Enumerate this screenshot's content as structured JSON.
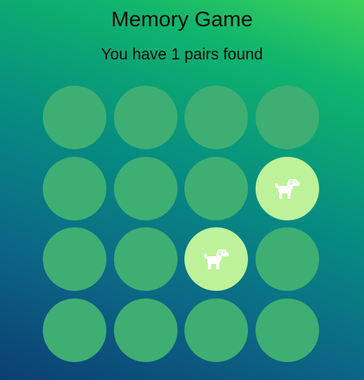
{
  "game": {
    "title": "Memory Game",
    "status": "You have 1 pairs found",
    "colors": {
      "card_hidden": "#3fae73",
      "card_revealed": "#bdf29a",
      "icon": "#ffffff"
    },
    "cards": [
      {
        "state": "hidden",
        "icon": null
      },
      {
        "state": "hidden",
        "icon": null
      },
      {
        "state": "hidden",
        "icon": null
      },
      {
        "state": "hidden",
        "icon": null
      },
      {
        "state": "hidden",
        "icon": null
      },
      {
        "state": "hidden",
        "icon": null
      },
      {
        "state": "hidden",
        "icon": null
      },
      {
        "state": "revealed",
        "icon": "dog-icon"
      },
      {
        "state": "hidden",
        "icon": null
      },
      {
        "state": "hidden",
        "icon": null
      },
      {
        "state": "revealed",
        "icon": "dog-icon"
      },
      {
        "state": "hidden",
        "icon": null
      },
      {
        "state": "hidden",
        "icon": null
      },
      {
        "state": "hidden",
        "icon": null
      },
      {
        "state": "hidden",
        "icon": null
      },
      {
        "state": "hidden",
        "icon": null
      }
    ]
  }
}
